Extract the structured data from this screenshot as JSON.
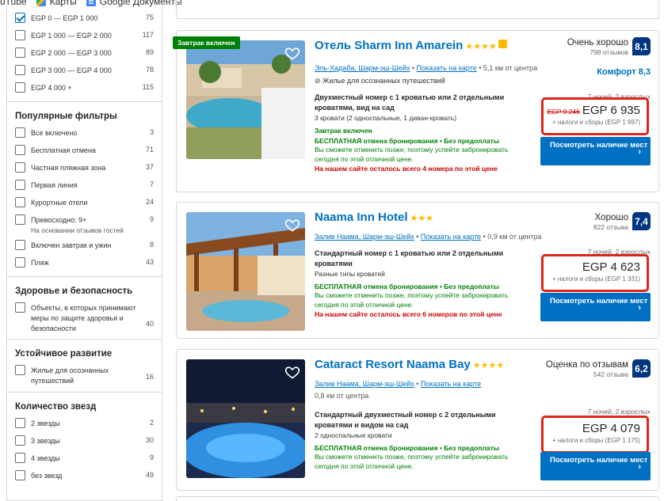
{
  "bookmarks": [
    {
      "label": "uTube",
      "icon": "youtube-icon"
    },
    {
      "label": "Карты",
      "icon": "maps-icon"
    },
    {
      "label": "Google Документы",
      "icon": "docs-icon"
    }
  ],
  "sidebar": {
    "budget": [
      {
        "label": "EGP 0 — EGP 1 000",
        "count": "75",
        "checked": true
      },
      {
        "label": "EGP 1 000 — EGP 2 000",
        "count": "117"
      },
      {
        "label": "EGP 2 000 — EGP 3 000",
        "count": "89"
      },
      {
        "label": "EGP 3 000 — EGP 4 000",
        "count": "78"
      },
      {
        "label": "EGP 4 000 +",
        "count": "115"
      }
    ],
    "popular": {
      "title": "Популярные фильтры",
      "items": [
        {
          "label": "Все включено",
          "count": "3"
        },
        {
          "label": "Бесплатная отмена",
          "count": "71"
        },
        {
          "label": "Частная пляжная зона",
          "count": "37"
        },
        {
          "label": "Первая линия",
          "count": "7"
        },
        {
          "label": "Курортные отели",
          "count": "24"
        },
        {
          "label": "Превосходно: 9+",
          "sub": "На основании отзывов гостей",
          "count": "9"
        },
        {
          "label": "Включен завтрак и ужин",
          "count": "8"
        },
        {
          "label": "Пляж",
          "count": "43"
        }
      ]
    },
    "health": {
      "title": "Здоровье и безопасность",
      "label": "Объекты, в которых принимают меры по защите здоровья и безопасности",
      "count": "40"
    },
    "sustain": {
      "title": "Устойчивое развитие",
      "label": "Жилье для осознанных путешествий",
      "count": "16"
    },
    "stars": {
      "title": "Количество звезд",
      "items": [
        {
          "label": "2 звезды",
          "count": "2"
        },
        {
          "label": "3 звезды",
          "count": "30"
        },
        {
          "label": "4 звезды",
          "count": "9"
        },
        {
          "label": "без звезд",
          "count": "49"
        }
      ]
    }
  },
  "hotels": [
    {
      "name": "Отель Sharm Inn Amarein",
      "stars": "★★★★",
      "badge": "Завтрак включен",
      "area": "Эль-Хадаба, Шарм-эш-Шейх",
      "map": "Показать на карте",
      "distance": "5,1 км от центра",
      "sustain": "Жилье для осознанных путешествий",
      "room_title": "Двухместный номер с 1 кроватью или 2 отдельными кроватями, вид на сад",
      "room_beds": "3 кровати (2 односпальные, 1 диван-кровать)",
      "breakfast": "Завтрак включен",
      "cancel": "БЕСПЛАТНАЯ отмена бронирования • Без предоплаты",
      "note": "Вы сможете отменить позже, поэтому успейте забронировать сегодня по этой отличной цене.",
      "left": "На нашем сайте осталось всего 4 номера по этой цене",
      "review_word": "Очень хорошо",
      "review_count": "798 отзывов",
      "score": "8,1",
      "comfort": "Комфорт 8,3",
      "nights": "7 ночей, 2 взрослых",
      "old_price": "EGP 9 246",
      "price": "EGP 6 935",
      "taxes": "+ налоги и сборы (EGP 1 997)",
      "button": "Посмотреть наличие мест"
    },
    {
      "name": "Naama Inn Hotel",
      "stars": "★★★",
      "area": "Залив Наама, Шарм-эш-Шейх",
      "map": "Показать на карте",
      "distance": "0,9 км от центра",
      "room_title": "Стандартный номер с 1 кроватью или 2 отдельными кроватями",
      "room_beds": "Разные типы кроватей",
      "cancel": "БЕСПЛАТНАЯ отмена бронирования • Без предоплаты",
      "note": "Вы сможете отменить позже, поэтому успейте забронировать сегодня по этой отличной цене.",
      "left": "На нашем сайте осталось всего 6 номеров по этой цене",
      "review_word": "Хорошо",
      "review_count": "822 отзыва",
      "score": "7,4",
      "nights": "7 ночей, 2 взрослых",
      "price": "EGP 4 623",
      "taxes": "+ налоги и сборы (EGP 1 331)",
      "button": "Посмотреть наличие мест"
    },
    {
      "name": "Cataract Resort Naama Bay",
      "stars": "★★★★",
      "area": "Залив Наама, Шарм-эш-Шейх",
      "map": "Показать на карте",
      "distance": "0,8 км от центра",
      "room_title": "Стандартный двухместный номер с 2 отдельными кроватями и видом на сад",
      "room_beds": "2 односпальные кровати",
      "cancel": "БЕСПЛАТНАЯ отмена бронирования • Без предоплаты",
      "note": "Вы сможете отменить позже, поэтому успейте забронировать сегодня по этой отличной цене.",
      "review_word": "Оценка по отзывам",
      "review_count": "542 отзыва",
      "score": "6,2",
      "nights": "7 ночей, 2 взрослых",
      "price": "EGP 4 079",
      "taxes": "+ налоги и сборы (EGP 1 175)",
      "button": "Посмотреть наличие мест"
    }
  ]
}
